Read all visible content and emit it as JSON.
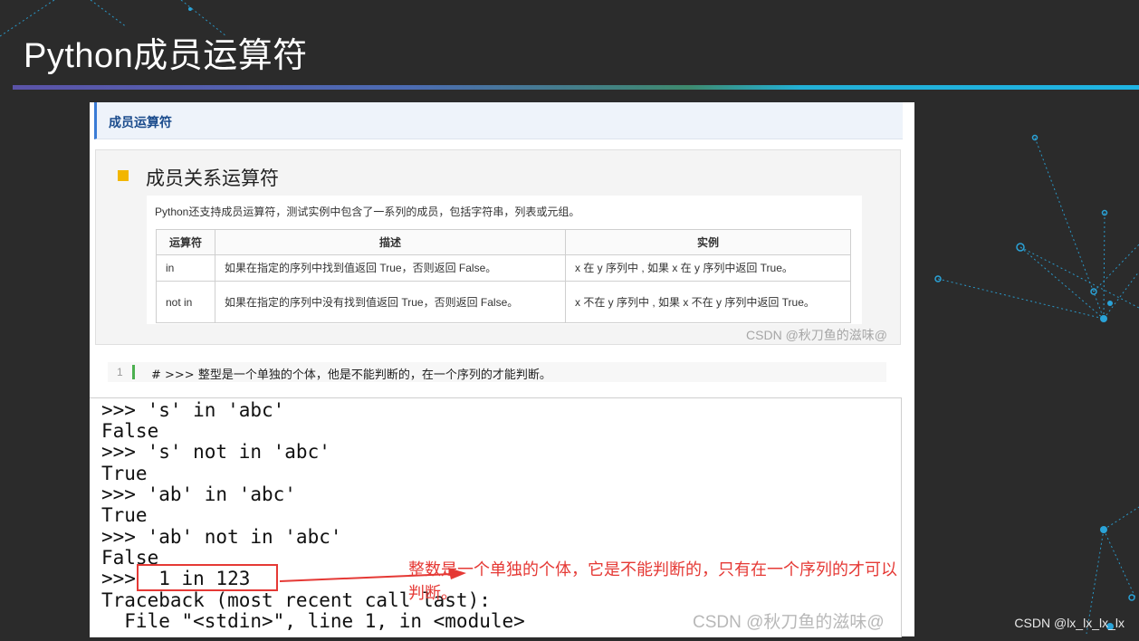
{
  "slide": {
    "title": "Python成员运算符"
  },
  "section": {
    "heading": "成员运算符"
  },
  "card": {
    "title": "成员关系运算符",
    "intro": "Python还支持成员运算符，测试实例中包含了一系列的成员，包括字符串，列表或元组。",
    "table": {
      "headers": [
        "运算符",
        "描述",
        "实例"
      ],
      "rows": [
        [
          "in",
          "如果在指定的序列中找到值返回 True，否则返回 False。",
          "x 在 y 序列中 , 如果 x 在 y 序列中返回 True。"
        ],
        [
          "not in",
          "如果在指定的序列中没有找到值返回 True，否则返回 False。",
          "x 不在 y 序列中 , 如果 x 不在 y 序列中返回 True。"
        ]
      ]
    },
    "watermark": "CSDN @秋刀鱼的滋味@"
  },
  "code": {
    "line_number": "1",
    "comment": "# >>> 整型是一个单独的个体，他是不能判断的，在一个序列的才能判断。"
  },
  "console": {
    "lines": [
      ">>> 's' in 'abc'",
      "False",
      ">>> 's' not in 'abc'",
      "True",
      ">>> 'ab' in 'abc'",
      "True",
      ">>> 'ab' not in 'abc'",
      "False",
      ">>>  1 in 123",
      "Traceback (most recent call last):",
      "  File \"<stdin>\", line 1, in <module>"
    ],
    "annotation": "整数是一个单独的个体，它是不能判断的，只有在一个序列的才可以判断。",
    "watermark": "CSDN @秋刀鱼的滋味@"
  },
  "footer": {
    "watermark": "CSDN @lx_lx_lx_lx"
  },
  "colors": {
    "background": "#2b2b2b",
    "accent_bullet": "#f2b600",
    "annotation": "#e53935",
    "network_lines": "#2aa3d8"
  }
}
